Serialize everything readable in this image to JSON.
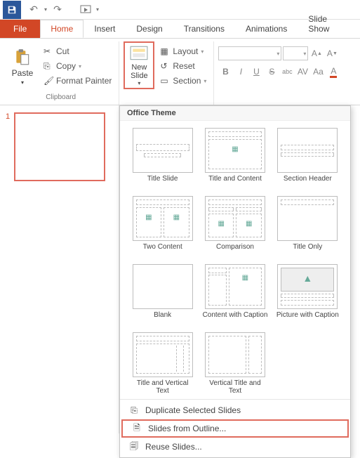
{
  "qat": {
    "save": "Save",
    "undo": "Undo",
    "redo": "Redo",
    "start": "Start From Beginning"
  },
  "tabs": {
    "file": "File",
    "home": "Home",
    "insert": "Insert",
    "design": "Design",
    "transitions": "Transitions",
    "animations": "Animations",
    "slideshow": "Slide Show"
  },
  "clipboard": {
    "paste": "Paste",
    "cut": "Cut",
    "copy": "Copy",
    "format_painter": "Format Painter",
    "group_label": "Clipboard"
  },
  "slides": {
    "new_slide": "New\nSlide",
    "layout": "Layout",
    "reset": "Reset",
    "section": "Section"
  },
  "font": {
    "bold": "B",
    "italic": "I",
    "underline": "U",
    "strike": "S",
    "shadow": "abc",
    "spacing": "AV",
    "case": "Aa",
    "increase": "A",
    "decrease": "A"
  },
  "slide_panel": {
    "current_num": "1"
  },
  "gallery": {
    "header": "Office Theme",
    "layouts": [
      {
        "name": "Title Slide",
        "kind": "title"
      },
      {
        "name": "Title and Content",
        "kind": "title-content"
      },
      {
        "name": "Section Header",
        "kind": "section"
      },
      {
        "name": "Two Content",
        "kind": "two"
      },
      {
        "name": "Comparison",
        "kind": "compare"
      },
      {
        "name": "Title Only",
        "kind": "title-only"
      },
      {
        "name": "Blank",
        "kind": "blank"
      },
      {
        "name": "Content with Caption",
        "kind": "content-cap"
      },
      {
        "name": "Picture with Caption",
        "kind": "pic-cap"
      },
      {
        "name": "Title and Vertical Text",
        "kind": "title-vert"
      },
      {
        "name": "Vertical Title and Text",
        "kind": "vert-title"
      }
    ],
    "menu": {
      "duplicate": "Duplicate Selected Slides",
      "from_outline": "Slides from Outline...",
      "reuse": "Reuse Slides..."
    }
  }
}
